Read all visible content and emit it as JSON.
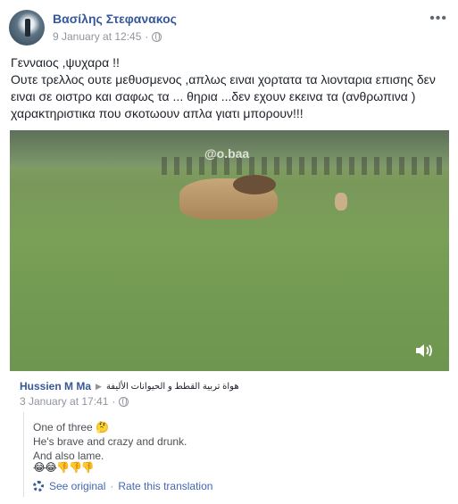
{
  "post": {
    "author": "Βασίλης Στεφανακος",
    "date": "9 January at 12:45",
    "separator": "·",
    "text_lines": [
      "Γενναιος ,ψυχαρα !!",
      "Ουτε τρελλος ουτε μεθυσμενος ,απλως ειναι χορτατα τα λιονταρια επισης δεν ειναι σε οιστρο και σαφως τα ... θηρια ...δεν εχουν εκεινα τα (ανθρωπινα ) χαρακτηριστικα που σκοτωουν απλα γιατι μπορουν!!!"
    ]
  },
  "video": {
    "watermark": "@o.baa"
  },
  "comment": {
    "name": "Hussien M Ma",
    "group": "هواة تربية القطط و الحيوانات الأليفة",
    "date": "3 January at 17:41",
    "separator": "·",
    "translation_lines": [
      "One of three 🤔",
      "He's brave and crazy and drunk.",
      "And also lame."
    ],
    "emojis": "😂😂👎👎👎",
    "see_original": "See original",
    "rate_translation": "Rate this translation",
    "link_separator": "·"
  },
  "colors": {
    "link": "#365899",
    "meta": "#90949c"
  },
  "icons": [
    "avatar",
    "globe-icon",
    "more-options-icon",
    "sound-icon",
    "gear-icon"
  ]
}
